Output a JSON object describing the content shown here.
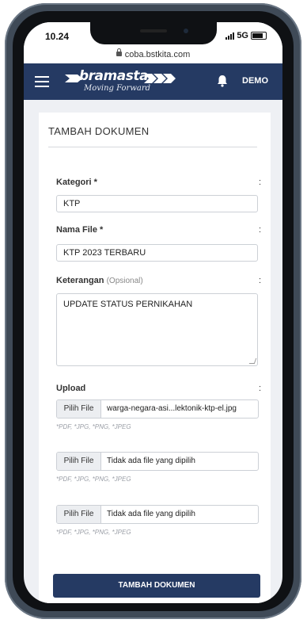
{
  "status": {
    "time": "10.24",
    "network": "5G"
  },
  "browser": {
    "url": "coba.bstkita.com"
  },
  "nav": {
    "logo_text": "bramasta",
    "logo_tagline": "Moving Forward",
    "user": "DEMO"
  },
  "form": {
    "title": "TAMBAH DOKUMEN",
    "kategori": {
      "label": "Kategori *",
      "value": "KTP"
    },
    "nama_file": {
      "label": "Nama File *",
      "value": "KTP 2023 TERBARU"
    },
    "keterangan": {
      "label": "Keterangan",
      "optional": "(Opsional)",
      "value": "UPDATE STATUS PERNIKAHAN"
    },
    "upload": {
      "label": "Upload",
      "button_label": "Pilih File",
      "files": [
        {
          "name": "warga-negara-asi...lektonik-ktp-el.jpg",
          "hint": "*PDF, *JPG, *PNG, *JPEG"
        },
        {
          "name": "Tidak ada file yang dipilih",
          "hint": "*PDF, *JPG, *PNG, *JPEG"
        },
        {
          "name": "Tidak ada file yang dipilih",
          "hint": "*PDF, *JPG, *PNG, *JPEG"
        }
      ]
    },
    "colon": ":",
    "submit_label": "TAMBAH DOKUMEN"
  }
}
